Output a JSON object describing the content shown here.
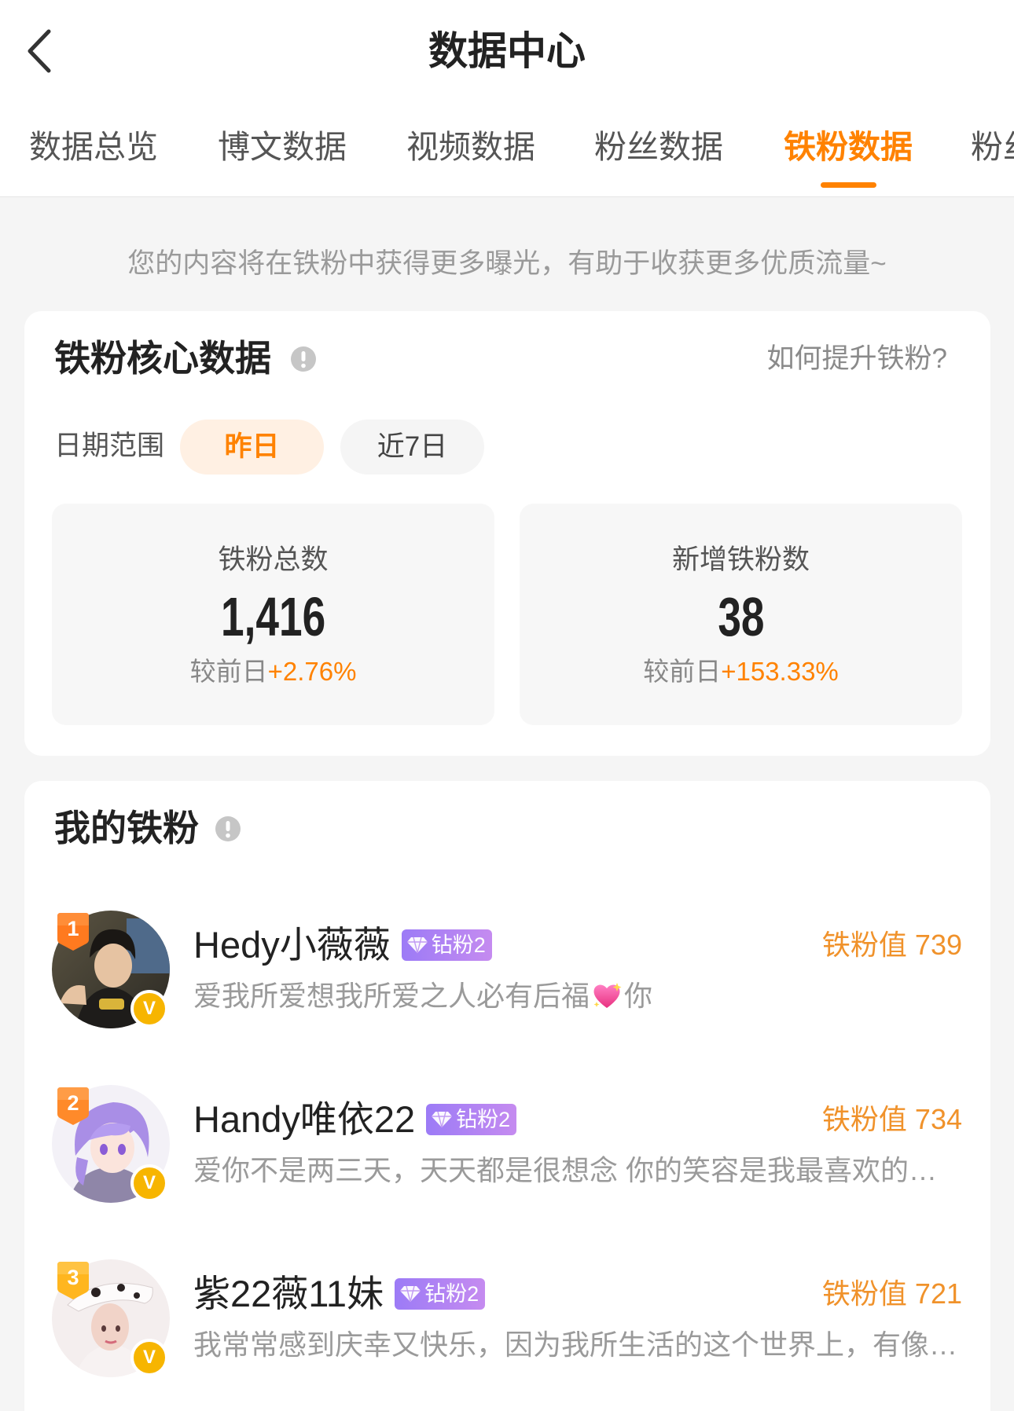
{
  "header": {
    "title": "数据中心",
    "back_icon": "chevron-left-icon"
  },
  "tabs": [
    {
      "label": "数据总览",
      "active": false
    },
    {
      "label": "博文数据",
      "active": false
    },
    {
      "label": "视频数据",
      "active": false
    },
    {
      "label": "粉丝数据",
      "active": false
    },
    {
      "label": "铁粉数据",
      "active": true
    },
    {
      "label": "粉丝",
      "active": false
    }
  ],
  "notice": "您的内容将在铁粉中获得更多曝光，有助于收获更多优质流量~",
  "core_card": {
    "title": "铁粉核心数据",
    "info_icon": "info-icon",
    "help_link": "如何提升铁粉?",
    "date_range": {
      "label": "日期范围",
      "options": [
        "昨日",
        "近7日"
      ],
      "selected": "昨日"
    },
    "stats": [
      {
        "label": "铁粉总数",
        "value": "1,416",
        "compare_label": "较前日",
        "change": "+2.76%"
      },
      {
        "label": "新增铁粉数",
        "value": "38",
        "compare_label": "较前日",
        "change": "+153.33%"
      }
    ]
  },
  "fans_card": {
    "title": "我的铁粉",
    "info_icon": "info-icon",
    "verified_mark": "V",
    "level_badge_icon": "diamond-icon",
    "fans": [
      {
        "rank": "1",
        "name": "Hedy小薇薇",
        "level_badge": "钻粉2",
        "score_label": "铁粉值",
        "score": "739",
        "bio_before_emoji": "爱我所爱想我所爱之人必有后福",
        "bio_emoji_icon": "sparkling-heart-icon",
        "bio_after_emoji": "你"
      },
      {
        "rank": "2",
        "name": "Handy唯依22",
        "level_badge": "钻粉2",
        "score_label": "铁粉值",
        "score": "734",
        "bio": "爱你不是两三天，天天都是很想念 你的笑容是我最喜欢的…"
      },
      {
        "rank": "3",
        "name": "紫22薇11妹",
        "level_badge": "钻粉2",
        "score_label": "铁粉值",
        "score": "721",
        "bio": "我常常感到庆幸又快乐，因为我所生活的这个世界上，有像…"
      }
    ]
  },
  "colors": {
    "accent": "#ff8200",
    "score": "#f0922b",
    "level_badge": "#b07cf0",
    "rank_1": "#ff7a1f",
    "rank_2": "#ff8a2a",
    "rank_3": "#ffb61f",
    "verified": "#f7b500",
    "background": "#f5f5f5"
  }
}
